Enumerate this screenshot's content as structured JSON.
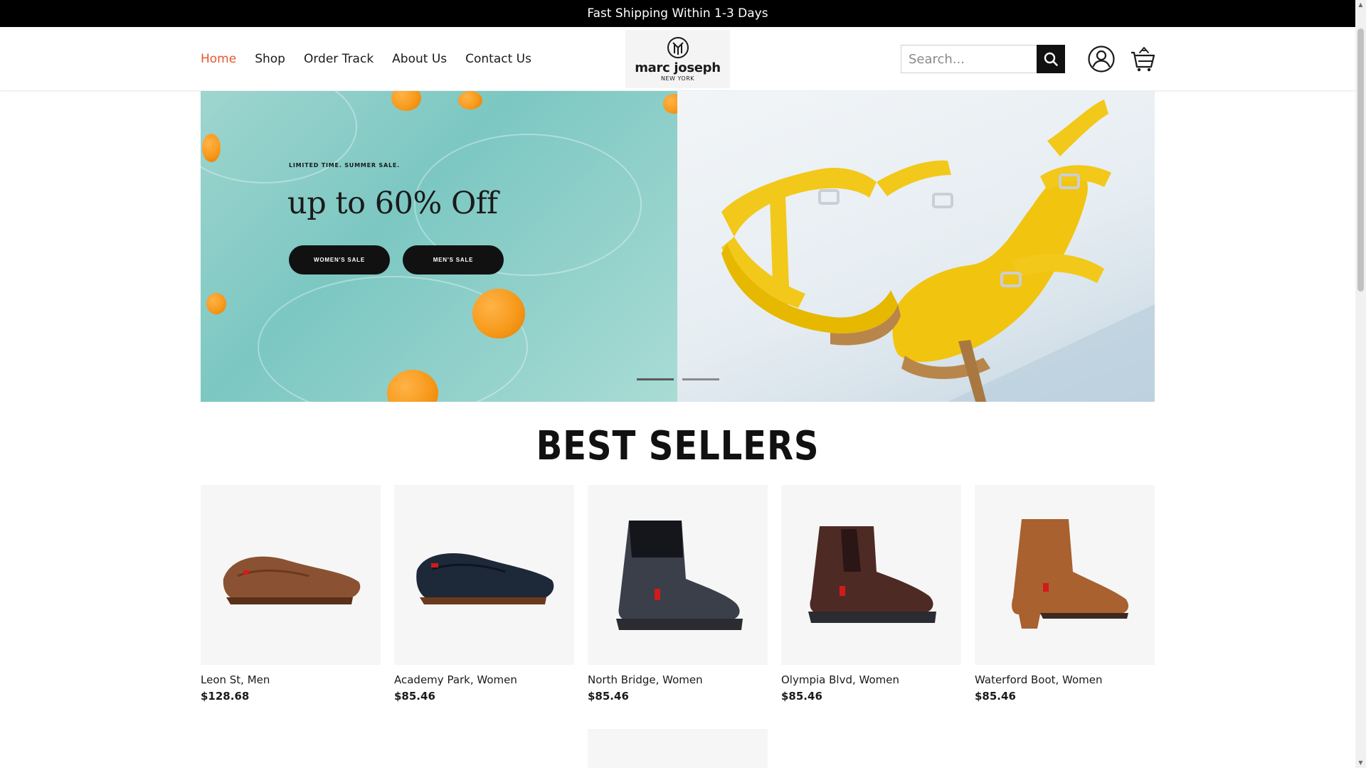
{
  "announcement": "Fast Shipping Within 1-3 Days",
  "nav": {
    "items": [
      {
        "label": "Home",
        "active": true
      },
      {
        "label": "Shop"
      },
      {
        "label": "Order Track"
      },
      {
        "label": "About Us"
      },
      {
        "label": "Contact Us"
      }
    ]
  },
  "logo": {
    "name": "marc joseph",
    "sub": "NEW YORK"
  },
  "search": {
    "placeholder": "Search..."
  },
  "hero": {
    "eyebrow": "LIMITED TIME. SUMMER SALE.",
    "headline": "up to 60% Off",
    "buttons": [
      "WOMEN'S SALE",
      "MEN'S SALE"
    ],
    "slide_count": 2
  },
  "best_sellers": {
    "title": "BEST SELLERS",
    "products": [
      {
        "name": "Leon St, Men",
        "price": "$128.68",
        "color": "#8a5232"
      },
      {
        "name": "Academy Park, Women",
        "price": "$85.46",
        "color": "#1d2838"
      },
      {
        "name": "North Bridge, Women",
        "price": "$85.46",
        "color": "#3a3f4a"
      },
      {
        "name": "Olympia Blvd, Women",
        "price": "$85.46",
        "color": "#4e2a24"
      },
      {
        "name": "Waterford Boot, Women",
        "price": "$85.46",
        "color": "#a8612f"
      }
    ]
  },
  "colors": {
    "accent": "#e4572e",
    "black": "#000000"
  }
}
